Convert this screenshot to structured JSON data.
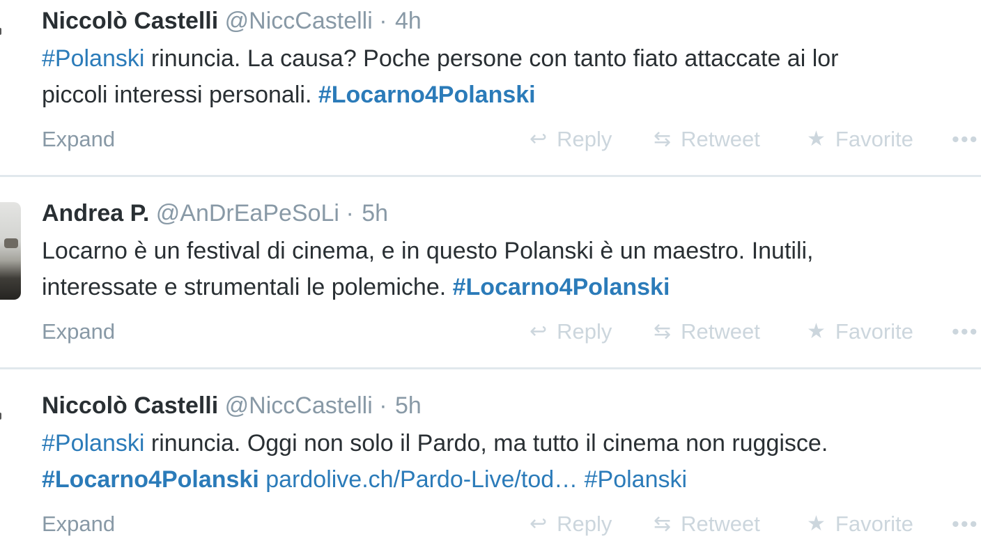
{
  "tweets": [
    {
      "fullname": "Niccolò Castelli",
      "username": "@NiccCastelli",
      "separator": "·",
      "time": "4h",
      "lines": [
        [
          {
            "type": "hashtag",
            "text": "#Polanski"
          },
          {
            "type": "text",
            "text": " rinuncia. La causa? Poche persone con tanto fiato attaccate ai lor"
          }
        ],
        [
          {
            "type": "text",
            "text": "piccoli interessi personali. "
          },
          {
            "type": "hashtag-bold",
            "text": "#Locarno4Polanski"
          }
        ]
      ],
      "expand": "Expand",
      "reply": "Reply",
      "retweet": "Retweet",
      "favorite": "Favorite",
      "more": "•••"
    },
    {
      "fullname": "Andrea P.",
      "username": "@AnDrEaPeSoLi",
      "separator": "·",
      "time": "5h",
      "lines": [
        [
          {
            "type": "text",
            "text": "Locarno è un festival di cinema, e in questo Polanski è un maestro. Inutili,"
          }
        ],
        [
          {
            "type": "text",
            "text": "interessate e strumentali le polemiche. "
          },
          {
            "type": "hashtag-bold",
            "text": "#Locarno4Polanski"
          }
        ]
      ],
      "expand": "Expand",
      "reply": "Reply",
      "retweet": "Retweet",
      "favorite": "Favorite",
      "more": "•••"
    },
    {
      "fullname": "Niccolò Castelli",
      "username": "@NiccCastelli",
      "separator": "·",
      "time": "5h",
      "lines": [
        [
          {
            "type": "hashtag",
            "text": "#Polanski"
          },
          {
            "type": "text",
            "text": " rinuncia. Oggi non solo il Pardo, ma tutto il cinema non ruggisce."
          }
        ],
        [
          {
            "type": "hashtag-bold",
            "text": "#Locarno4Polanski"
          },
          {
            "type": "text",
            "text": " "
          },
          {
            "type": "link",
            "text": "pardolive.ch/Pardo-Live/tod…"
          },
          {
            "type": "text",
            "text": " "
          },
          {
            "type": "hashtag",
            "text": "#Polanski"
          }
        ]
      ],
      "expand": "Expand",
      "reply": "Reply",
      "retweet": "Retweet",
      "favorite": "Favorite",
      "more": "•••"
    }
  ],
  "icons": {
    "reply": "reply-arrow-icon",
    "retweet": "retweet-icon",
    "favorite": "star-icon",
    "more": "more-dots-icon"
  },
  "colors": {
    "link": "#2b7bb9",
    "name": "#292f33",
    "muted": "#8899a6",
    "action": "#ccd6dd",
    "divider": "#e1e8ed"
  }
}
